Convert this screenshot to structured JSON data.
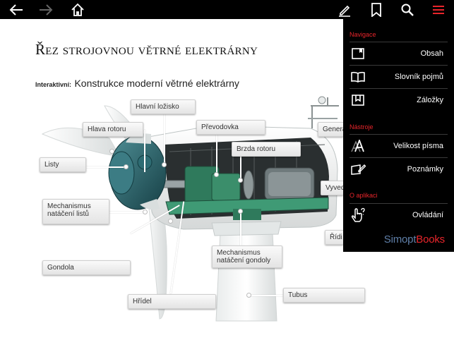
{
  "toolbar": {
    "buttons": [
      "back-arrow-icon",
      "forward-arrow-icon",
      "home-icon",
      "pencil-icon",
      "bookmark-icon",
      "search-icon",
      "menu-icon"
    ],
    "accent_color": "#e8252b"
  },
  "page": {
    "title": "Řez strojovnou větrné elektrárny",
    "subtitle_tag": "Interaktivní:",
    "subtitle_text": "Konstrukce moderní větrné elektrárny"
  },
  "callouts": {
    "hlavni_lozisko": "Hlavní ložisko",
    "hlava_rotoru": "Hlava rotoru",
    "prevodovka": "Převodovka",
    "brzda_rotoru": "Brzda rotoru",
    "generator": "Genera",
    "listy": "Listy",
    "vyvedeni": "Vyved",
    "mechanismus_natoceni_listu_1": "Mechanismus",
    "mechanismus_natoceni_listu_2": "natáčení listů",
    "ridici": "Řídi",
    "mechanismus_natoceni_gondoly_1": "Mechanismus",
    "mechanismus_natoceni_gondoly_2": "natáčení gondoly",
    "gondola": "Gondola",
    "tubus": "Tubus",
    "hridel": "Hřídel"
  },
  "menu": {
    "navigace": {
      "title": "Navigace",
      "items": [
        {
          "label": "Obsah",
          "icon": "contents-icon"
        },
        {
          "label": "Slovník pojmů",
          "icon": "open-book-icon"
        },
        {
          "label": "Záložky",
          "icon": "bookmarks-icon"
        }
      ]
    },
    "nastroje": {
      "title": "Nástroje",
      "items": [
        {
          "label": "Velikost písma",
          "icon": "font-size-icon"
        },
        {
          "label": "Poznámky",
          "icon": "notes-icon"
        }
      ]
    },
    "o_aplikaci": {
      "title": "O aplikaci",
      "items": [
        {
          "label": "Ovládání",
          "icon": "touch-help-icon"
        }
      ]
    },
    "brand_part1": "Simopt",
    "brand_part2": "Books"
  }
}
